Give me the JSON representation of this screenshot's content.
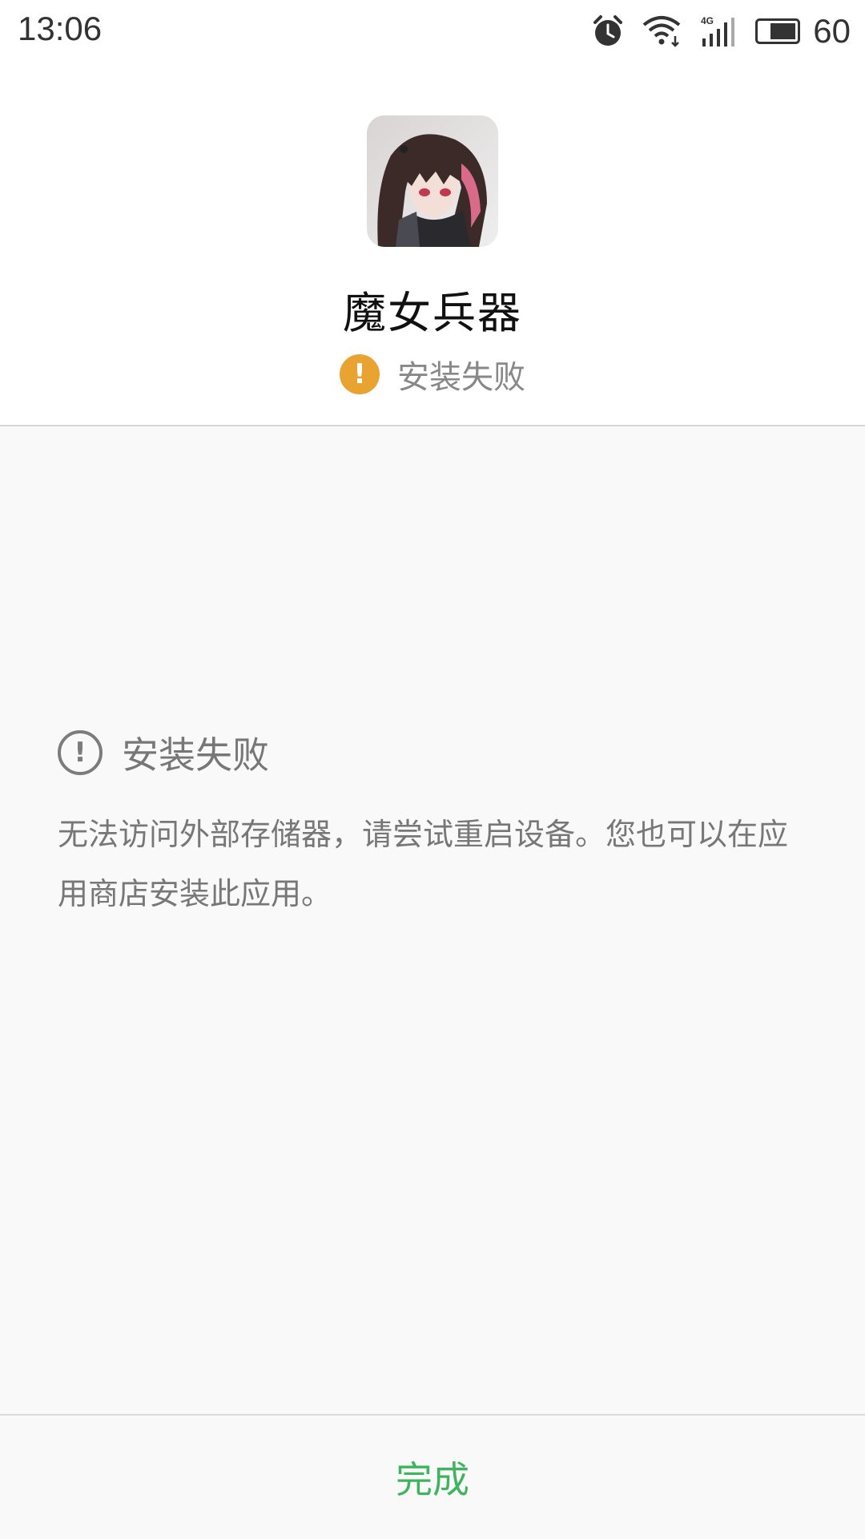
{
  "status_bar": {
    "time": "13:06",
    "battery": "60",
    "icons": [
      "alarm-icon",
      "wifi-icon",
      "signal-4g-icon",
      "battery-icon"
    ],
    "network_label": "4G"
  },
  "app": {
    "name": "魔女兵器",
    "status": "安装失败",
    "icon": "app-icon-anime-character"
  },
  "error": {
    "title": "安装失败",
    "message": "无法访问外部存储器，请尝试重启设备。您也可以在应用商店安装此应用。"
  },
  "footer": {
    "done_label": "完成"
  },
  "colors": {
    "warning": "#e8a330",
    "accent_green": "#3fb45f",
    "background": "#f9f9f9"
  }
}
